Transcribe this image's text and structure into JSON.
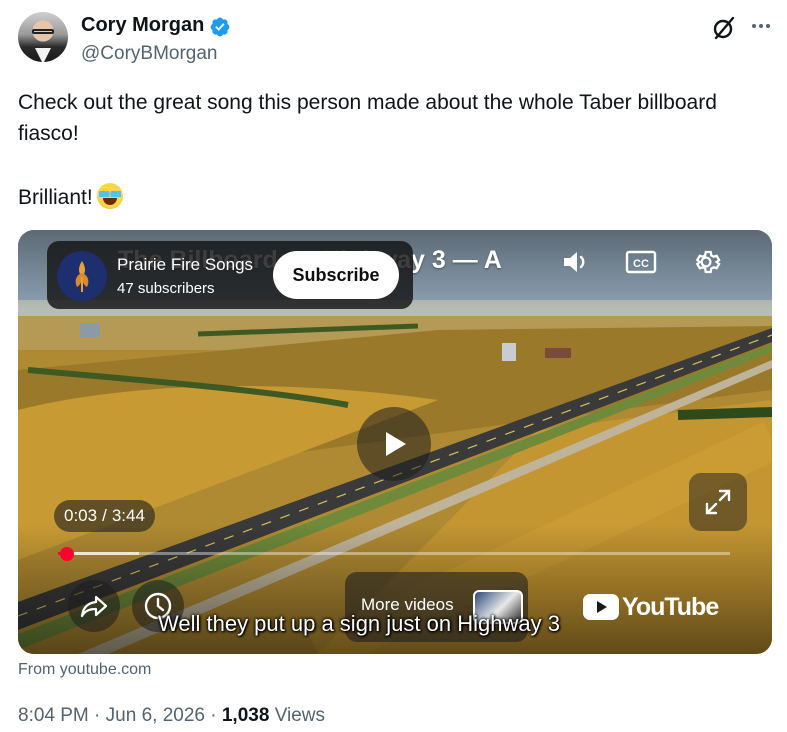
{
  "author": {
    "name": "Cory Morgan",
    "handle": "@CoryBMorgan",
    "verified": true
  },
  "tweet": {
    "line1": "Check out the great song this person made about the whole Taber billboard fiasco!",
    "line2": "Brilliant!",
    "emoji": "face-with-tears-of-joy"
  },
  "video": {
    "title": "The Billboard on Highway 3 — A",
    "channel_name": "Prairie Fire Songs",
    "subscribers": "47 subscribers",
    "subscribe_label": "Subscribe",
    "current_time": "0:03",
    "time_separator": "/",
    "duration": "3:44",
    "progress_fraction": 0.0134,
    "buffered_fraction": 0.12,
    "more_videos_label": "More videos",
    "youtube_label": "YouTube",
    "caption": "Well they put up a sign just on Highway 3",
    "icons": {
      "volume": "volume-icon",
      "cc": "closed-captions-icon",
      "settings": "settings-gear-icon",
      "play": "play-icon",
      "share": "share-icon",
      "watch_later": "clock-icon",
      "fullscreen": "fullscreen-icon"
    }
  },
  "source_label": "From youtube.com",
  "meta": {
    "time": "8:04 PM",
    "dot": "·",
    "date": "Jun 6, 2026",
    "views_count": "1,038",
    "views_label": "Views"
  },
  "colors": {
    "verified_blue": "#1d9bf0",
    "text_primary": "#0f1419",
    "text_secondary": "#536471",
    "youtube_red": "#ff0033"
  }
}
